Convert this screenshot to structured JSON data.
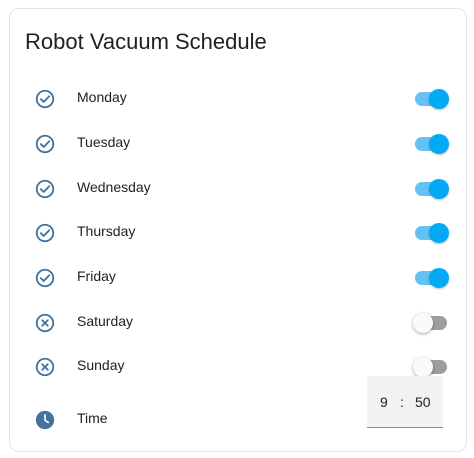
{
  "card": {
    "title": "Robot Vacuum Schedule"
  },
  "days": [
    {
      "label": "Monday",
      "enabled": true,
      "icon": "check-circle-icon"
    },
    {
      "label": "Tuesday",
      "enabled": true,
      "icon": "check-circle-icon"
    },
    {
      "label": "Wednesday",
      "enabled": true,
      "icon": "check-circle-icon"
    },
    {
      "label": "Thursday",
      "enabled": true,
      "icon": "check-circle-icon"
    },
    {
      "label": "Friday",
      "enabled": true,
      "icon": "check-circle-icon"
    },
    {
      "label": "Saturday",
      "enabled": false,
      "icon": "close-circle-icon"
    },
    {
      "label": "Sunday",
      "enabled": false,
      "icon": "close-circle-icon"
    }
  ],
  "time": {
    "label": "Time",
    "icon": "clock-icon",
    "hour": "9",
    "separator": ":",
    "minute": "50"
  },
  "colors": {
    "icon": "#44739e",
    "toggle_on": "#03a9f4",
    "toggle_on_track": "#63c1f4",
    "toggle_off_track": "#9e9e9e",
    "text": "#212121"
  }
}
